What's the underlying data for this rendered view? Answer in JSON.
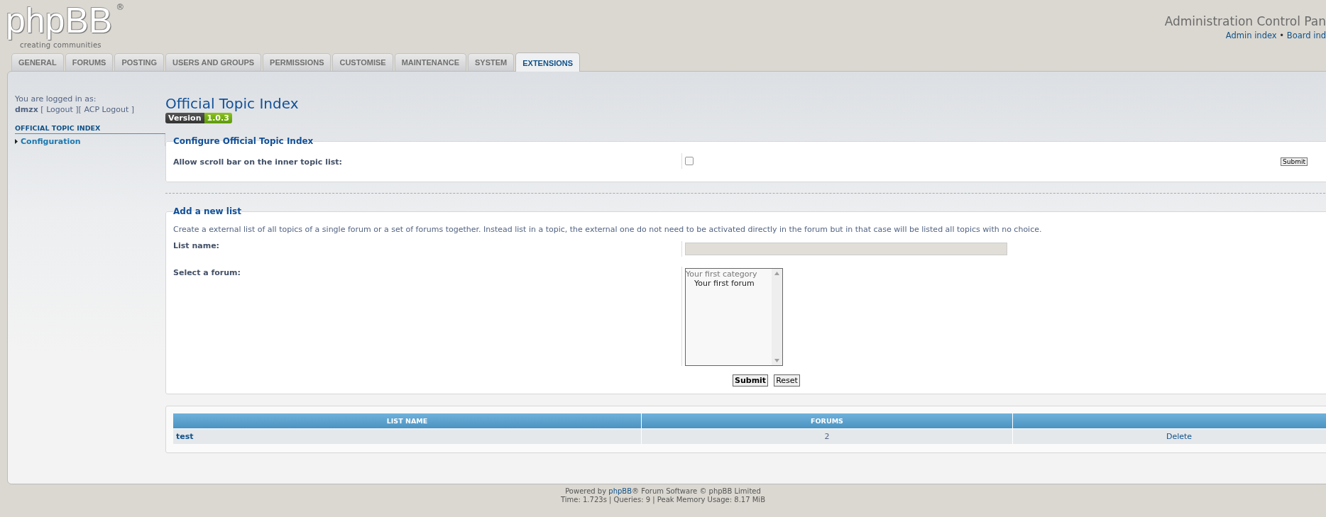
{
  "logo": {
    "wordmark": "phpBB",
    "mark": "®",
    "tagline": "creating communities"
  },
  "header": {
    "title": "Administration Control Pan",
    "nav": [
      {
        "kind": "link",
        "text": "Admin index"
      },
      {
        "kind": "text",
        "text": " • "
      },
      {
        "kind": "link",
        "text": "Board ind"
      }
    ]
  },
  "tabs": [
    {
      "label": "GENERAL",
      "selected": false
    },
    {
      "label": "FORUMS",
      "selected": false
    },
    {
      "label": "POSTING",
      "selected": false
    },
    {
      "label": "USERS AND GROUPS",
      "selected": false
    },
    {
      "label": "PERMISSIONS",
      "selected": false
    },
    {
      "label": "CUSTOMISE",
      "selected": false
    },
    {
      "label": "MAINTENANCE",
      "selected": false
    },
    {
      "label": "SYSTEM",
      "selected": false
    },
    {
      "label": "EXTENSIONS",
      "selected": true
    }
  ],
  "sidebar": {
    "logged_in_label": "You are logged in as:",
    "user_line": [
      {
        "kind": "user",
        "text": "dmzx"
      },
      {
        "kind": "text",
        "text": " [ "
      },
      {
        "kind": "link",
        "text": "Logout"
      },
      {
        "kind": "text",
        "text": " ][ "
      },
      {
        "kind": "link",
        "text": "ACP Logout"
      },
      {
        "kind": "text",
        "text": " ]"
      }
    ],
    "section": "OFFICIAL TOPIC INDEX",
    "items": [
      {
        "label": "Configuration"
      }
    ]
  },
  "page": {
    "title": "Official Topic Index",
    "version_label": "Version",
    "version": "1.0.3"
  },
  "config": {
    "legend": "Configure Official Topic Index",
    "label": "Allow scroll bar on the inner topic list:",
    "checked": false,
    "submit": "Submit"
  },
  "add_list": {
    "legend": "Add a new list",
    "description": "Create a external list of all topics of a single forum or a set of forums together. Instead list in a topic, the external one do not need to be activated directly in the forum but in that case will be listed all topics with no choice.",
    "name_label": "List name:",
    "forum_label": "Select a forum:",
    "options": [
      {
        "kind": "category",
        "text": "Your first category"
      },
      {
        "kind": "forum",
        "text": "Your first forum"
      }
    ],
    "submit": "Submit",
    "reset": "Reset"
  },
  "table": {
    "columns": [
      "LIST NAME",
      "FORUMS"
    ],
    "rows": [
      {
        "name": "test",
        "forums": "2",
        "action": "Delete"
      }
    ]
  },
  "footer": {
    "line1": [
      {
        "kind": "text",
        "text": "Powered by "
      },
      {
        "kind": "link",
        "text": "phpBB"
      },
      {
        "kind": "text",
        "text": "® Forum Software © phpBB Limited"
      }
    ],
    "line2": "Time: 1.723s | Queries: 9 | Peak Memory Usage: 8.17 MiB"
  }
}
